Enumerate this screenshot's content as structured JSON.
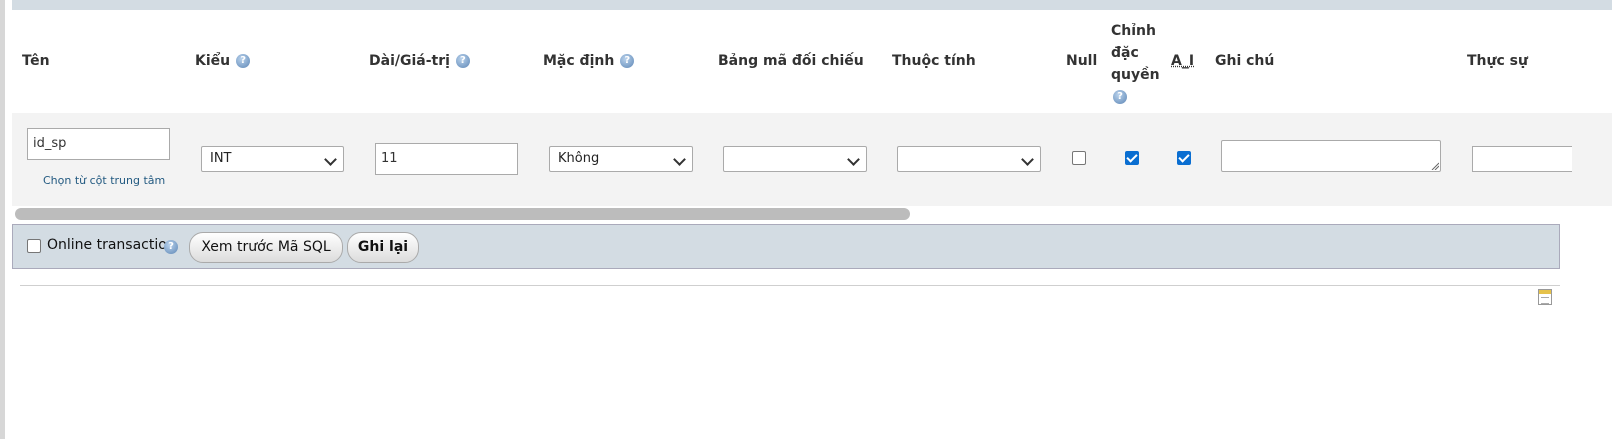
{
  "columns": {
    "name": "Tên",
    "type": "Kiểu",
    "length": "Dài/Giá-trị",
    "default": "Mặc định",
    "collation": "Bảng mã đối chiếu",
    "attributes": "Thuộc tính",
    "null": "Null",
    "index_line1": "Chỉnh",
    "index_line2": "đặc",
    "index_line3": "quyền",
    "ai": "A_I",
    "comments": "Ghi chú",
    "virtuality": "Thực sự"
  },
  "row": {
    "name_value": "id_sp",
    "pick_central": "Chọn từ cột trung tâm",
    "type_value": "INT",
    "length_value": "11",
    "default_value": "Không",
    "collation_value": "",
    "attributes_value": "",
    "null_checked": false,
    "index_checked": true,
    "ai_checked": true,
    "comments_value": "",
    "virtuality_value": ""
  },
  "footer": {
    "online_transaction": "Online transaction",
    "preview_sql": "Xem trước Mã SQL",
    "save": "Ghi lại"
  },
  "icons": {
    "help": "help-icon",
    "page": "page-icon"
  },
  "colors": {
    "header_bar": "#d3dce3",
    "row_bg": "#f3f3f3",
    "checkbox_on": "#0a6ed1",
    "link": "#235a81"
  }
}
